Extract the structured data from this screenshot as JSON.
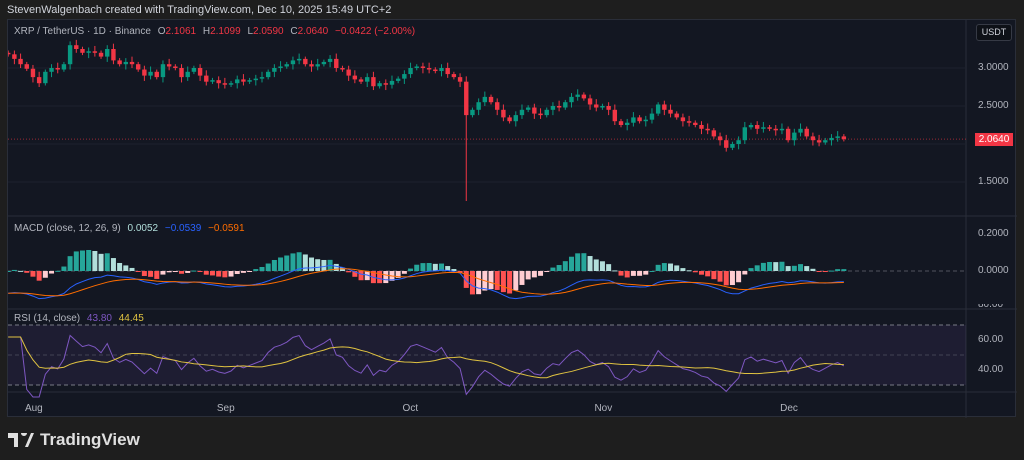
{
  "caption": "StevenWalgenbach created with TradingView.com, Dec 10, 2025 15:49 UTC+2",
  "symbol": {
    "title": "XRP / TetherUS · 1D · Binance",
    "o_label": "O",
    "o": "2.1061",
    "h_label": "H",
    "h": "2.1099",
    "l_label": "L",
    "l": "2.0590",
    "c_label": "C",
    "c": "2.0640",
    "change": "−0.0422 (−2.00%)"
  },
  "currency": "USDT",
  "last_price": "2.0640",
  "price_axis": [
    "3.0000",
    "2.5000",
    "1.5000"
  ],
  "macd": {
    "label": "MACD (close, 12, 26, 9)",
    "hist": "0.0052",
    "macd": "−0.0539",
    "signal": "−0.0591",
    "axis": [
      "0.2000",
      "0.0000"
    ]
  },
  "rsi": {
    "label": "RSI (14, close)",
    "rsi": "43.80",
    "ma": "44.45",
    "axis": [
      "80.00",
      "60.00",
      "40.00"
    ]
  },
  "time_axis": [
    "Aug",
    "Sep",
    "Oct",
    "Nov",
    "Dec"
  ],
  "logo": "TradingView",
  "colors": {
    "up": "#089981",
    "down": "#f23645",
    "macd": "#2962ff",
    "signal": "#ff6d00",
    "rsi": "#7e57c2",
    "rsi_ma": "#e0c341"
  },
  "chart_data": {
    "type": "candlestick",
    "start_date": "Jul 28",
    "closes": [
      3.18,
      3.12,
      3.05,
      2.99,
      2.88,
      2.8,
      2.95,
      3.0,
      2.98,
      3.05,
      3.3,
      3.25,
      3.2,
      3.22,
      3.2,
      3.15,
      3.25,
      3.1,
      3.05,
      3.08,
      3.05,
      2.98,
      2.9,
      2.95,
      2.88,
      3.05,
      3.02,
      3.0,
      2.88,
      2.95,
      3.0,
      2.9,
      2.82,
      2.84,
      2.8,
      2.78,
      2.8,
      2.85,
      2.82,
      2.84,
      2.86,
      2.88,
      2.95,
      3.0,
      3.02,
      3.05,
      3.1,
      3.12,
      3.05,
      3.02,
      3.05,
      3.08,
      3.12,
      3.0,
      2.98,
      2.9,
      2.85,
      2.82,
      2.88,
      2.76,
      2.8,
      2.78,
      2.83,
      2.86,
      2.92,
      3.0,
      3.02,
      3.0,
      2.98,
      2.96,
      3.0,
      2.92,
      2.88,
      2.82,
      2.38,
      2.45,
      2.55,
      2.62,
      2.55,
      2.45,
      2.35,
      2.3,
      2.38,
      2.45,
      2.48,
      2.4,
      2.38,
      2.45,
      2.5,
      2.48,
      2.55,
      2.62,
      2.65,
      2.6,
      2.52,
      2.48,
      2.5,
      2.45,
      2.3,
      2.25,
      2.28,
      2.35,
      2.3,
      2.32,
      2.4,
      2.52,
      2.45,
      2.4,
      2.35,
      2.3,
      2.28,
      2.25,
      2.2,
      2.18,
      2.1,
      2.05,
      1.95,
      2.0,
      2.05,
      2.22,
      2.25,
      2.2,
      2.22,
      2.2,
      2.18,
      2.2,
      2.05,
      2.15,
      2.2,
      2.1,
      2.05,
      2.02,
      2.05,
      2.08,
      2.1,
      2.064
    ],
    "wick_low": {
      "date": "Oct 10",
      "value": 1.25
    },
    "ylim": [
      1.1,
      3.45
    ],
    "month_start_index": {
      "Aug": 4,
      "Sep": 35,
      "Oct": 65,
      "Nov": 96,
      "Dec": 126
    }
  }
}
